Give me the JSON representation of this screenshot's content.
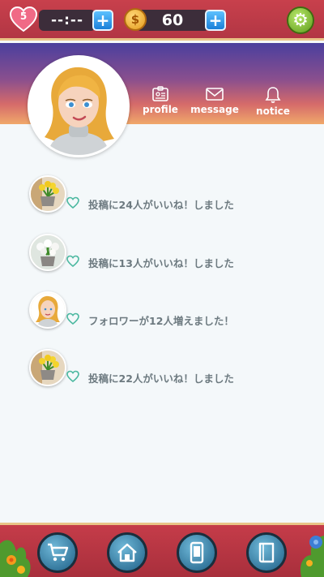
{
  "topbar": {
    "lives_count": "5",
    "lives_timer": "--:--",
    "coins": "60",
    "plus_symbol": "+",
    "coin_symbol": "$"
  },
  "nav": {
    "profile": "profile",
    "message": "message",
    "notice": "notice"
  },
  "notifications": [
    {
      "thumb": "flower-pot-yellow",
      "text": "投稿に24人がいいね！しました"
    },
    {
      "thumb": "flower-pot-white",
      "text": "投稿に13人がいいね！しました"
    },
    {
      "thumb": "girl-avatar",
      "text": "フォロワーが12人増えました！"
    },
    {
      "thumb": "flower-pot-yellow",
      "text": "投稿に22人がいいね！しました"
    }
  ],
  "bottom_nav": [
    "cart-icon",
    "home-icon",
    "phone-icon",
    "book-icon"
  ],
  "colors": {
    "topbar": "#b23644",
    "accent_blue": "#1a7fd8",
    "like_heart": "#4bb8a0",
    "text_gray": "#6d7a80"
  }
}
